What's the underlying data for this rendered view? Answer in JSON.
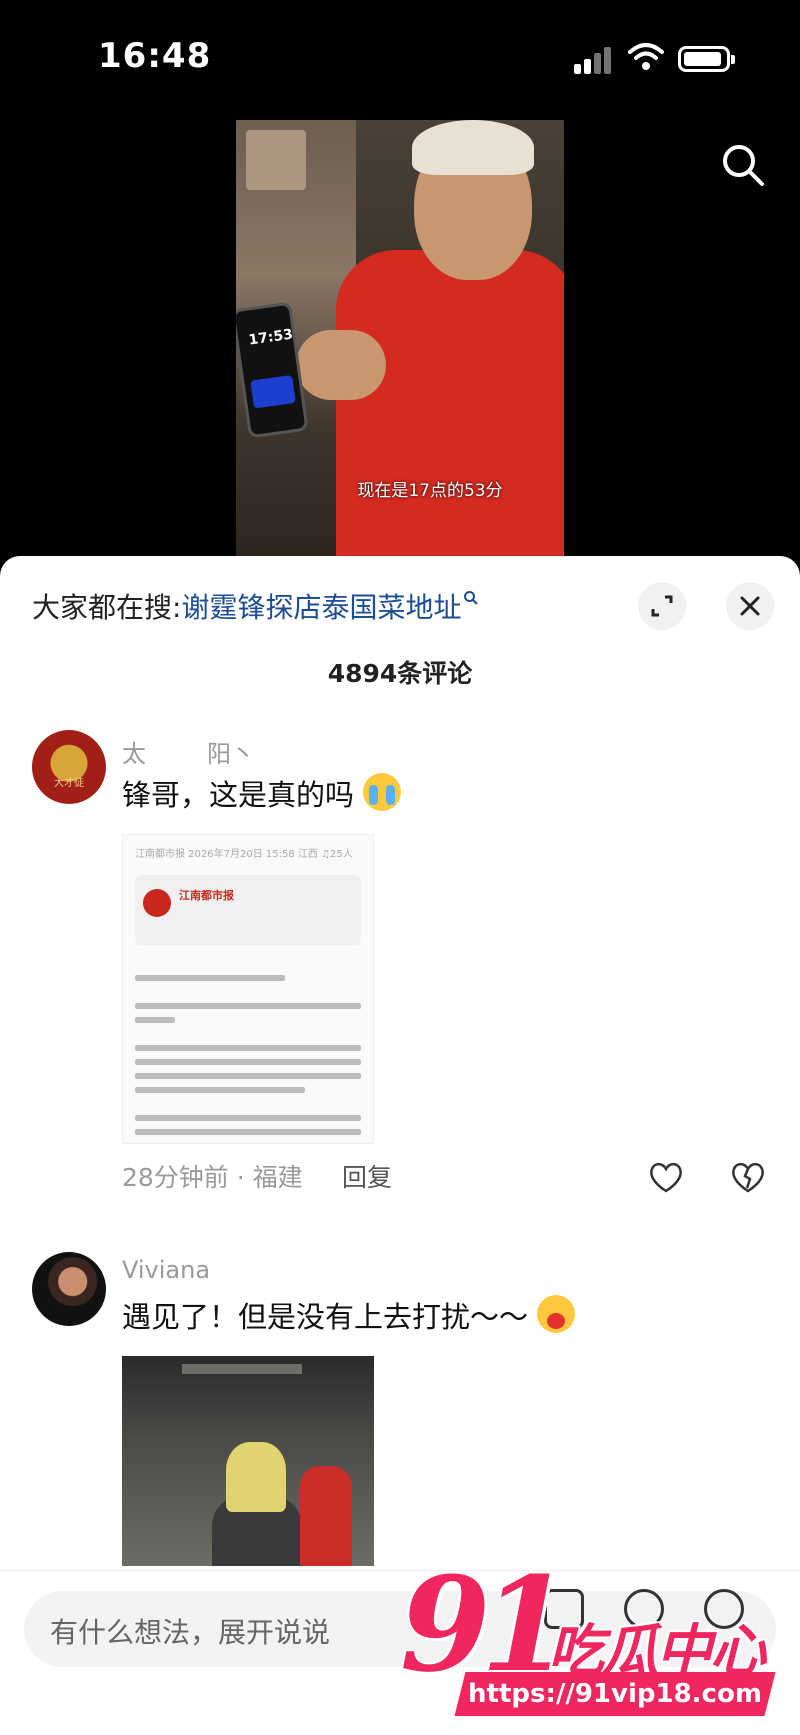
{
  "status_bar": {
    "time": "16:48"
  },
  "video": {
    "subtitle": "现在是17点的53分",
    "phone_time": "17:53"
  },
  "sheet": {
    "hot_search_prefix": "大家都在搜:",
    "hot_search_keyword": "谢霆锋探店泰国菜地址",
    "comment_count": "4894条评论"
  },
  "comments": [
    {
      "username": "太        阳丶",
      "text": "锋哥，这是真的吗",
      "emoji": "crying-face",
      "image": {
        "source_line": "江南都市报  2026年7月20日 15:58  江西  ♫25人",
        "account_name": "江南都市报"
      },
      "meta": "28分钟前 · 福建",
      "reply_label": "回复"
    },
    {
      "username": "Viviana",
      "text": "遇见了！但是没有上去打扰～～",
      "emoji": "hugging-face"
    }
  ],
  "input": {
    "placeholder": "有什么想法，展开说说"
  },
  "watermark": {
    "number": "91",
    "name": "吃瓜中心",
    "url": "https://91vip18.com"
  },
  "colors": {
    "accent": "#f0265f",
    "link": "#1c4e95",
    "jacket": "#d42a1f"
  }
}
